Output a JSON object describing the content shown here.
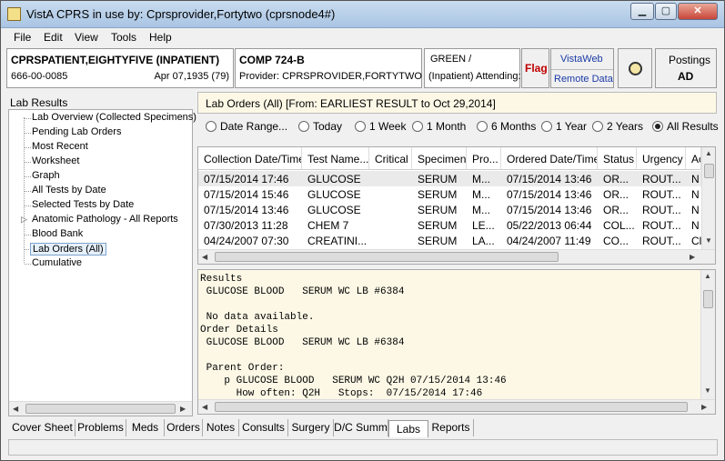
{
  "window": {
    "title": "VistA CPRS in use by: Cprsprovider,Fortytwo  (cprsnode4#)",
    "controls": [
      "▁",
      "▢",
      "✕"
    ]
  },
  "menu": [
    "File",
    "Edit",
    "View",
    "Tools",
    "Help"
  ],
  "patient": {
    "name": "CPRSPATIENT,EIGHTYFIVE (INPATIENT)",
    "ssn": "666-00-0085",
    "dob": "Apr 07,1935 (79)",
    "location": "COMP 724-B",
    "provider": "Provider:  CPRSPROVIDER,FORTYTWO",
    "team": "GREEN /",
    "attending": "(Inpatient) Attending:",
    "flag": "Flag",
    "vistaweb": "VistaWeb",
    "remote_data": "Remote Data",
    "postings_label": "Postings",
    "postings_value": "AD"
  },
  "lab_tree": {
    "title": "Lab Results",
    "items": [
      "Lab Overview (Collected Specimens)",
      "Pending Lab Orders",
      "Most Recent",
      "Worksheet",
      "Graph",
      "All Tests by Date",
      "Selected Tests by Date",
      "Anatomic Pathology - All Reports",
      "Blood Bank",
      "Lab Orders (All)",
      "Cumulative"
    ],
    "selected": "Lab Orders (All)"
  },
  "range_header": "Lab Orders (All) [From: EARLIEST RESULT to Oct 29,2014]",
  "date_ranges": [
    "Date Range...",
    "Today",
    "1 Week",
    "1 Month",
    "6 Months",
    "1 Year",
    "2 Years",
    "All Results"
  ],
  "selected_range": "All Results",
  "orders_table": {
    "columns": [
      "Collection Date/Time",
      "Test Name...",
      "Critical",
      "Specimen",
      "Pro...",
      "Ordered Date/Time",
      "Status",
      "Urgency",
      "Ac"
    ],
    "rows": [
      [
        "07/15/2014 17:46",
        "GLUCOSE",
        "",
        "SERUM",
        "M...",
        "07/15/2014 13:46",
        "OR...",
        "ROUT...",
        "N"
      ],
      [
        "07/15/2014 15:46",
        "GLUCOSE",
        "",
        "SERUM",
        "M...",
        "07/15/2014 13:46",
        "OR...",
        "ROUT...",
        "N"
      ],
      [
        "07/15/2014 13:46",
        "GLUCOSE",
        "",
        "SERUM",
        "M...",
        "07/15/2014 13:46",
        "OR...",
        "ROUT...",
        "N"
      ],
      [
        "07/30/2013 11:28",
        "CHEM 7",
        "",
        "SERUM",
        "LE...",
        "05/22/2013 06:44",
        "COL...",
        "ROUT...",
        "N"
      ],
      [
        "04/24/2007 07:30",
        "CREATINI...",
        "",
        "SERUM",
        "LA...",
        "04/24/2007 11:49",
        "CO...",
        "ROUT...",
        "Cl"
      ]
    ]
  },
  "report_lines": [
    "Results",
    " GLUCOSE BLOOD   SERUM WC LB #6384",
    "",
    " No data available.",
    "Order Details",
    " GLUCOSE BLOOD   SERUM WC LB #6384",
    "",
    " Parent Order:",
    "    p GLUCOSE BLOOD   SERUM WC Q2H 07/15/2014 13:46",
    "      How often: Q2H   Stops:  07/15/2014 17:46"
  ],
  "tabs": [
    "Cover Sheet",
    "Problems",
    "Meds",
    "Orders",
    "Notes",
    "Consults",
    "Surgery",
    "D/C Summ",
    "Labs",
    "Reports"
  ],
  "active_tab": "Labs"
}
